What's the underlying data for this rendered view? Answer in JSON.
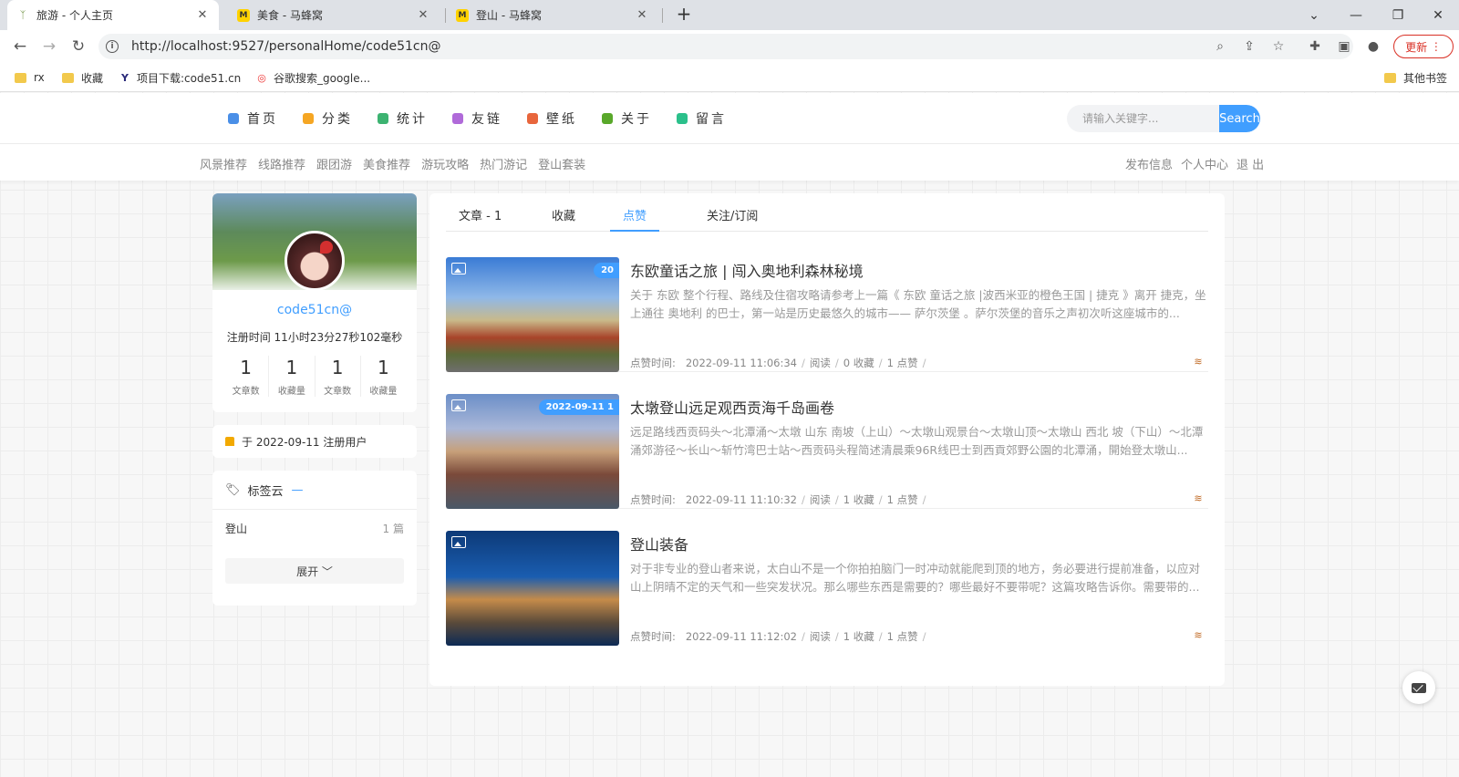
{
  "browser": {
    "tabs": [
      {
        "title": "旅游 - 个人主页",
        "active": true
      },
      {
        "title": "美食 - 马蜂窝",
        "active": false
      },
      {
        "title": "登山 - 马蜂窝",
        "active": false
      }
    ],
    "new_tab": "+",
    "url": "http://localhost:9527/personalHome/code51cn@",
    "update_label": "更新",
    "bookmarks": [
      "rx",
      "收藏",
      "项目下载:code51.cn",
      "谷歌搜索_google...",
      "其他书签"
    ]
  },
  "nav": {
    "menu": [
      {
        "label": "首页",
        "color": "#4a8fe7"
      },
      {
        "label": "分类",
        "color": "#f5a623"
      },
      {
        "label": "统计",
        "color": "#3cb371"
      },
      {
        "label": "友链",
        "color": "#b06ad9"
      },
      {
        "label": "壁纸",
        "color": "#e8663c"
      },
      {
        "label": "关于",
        "color": "#59a82a"
      },
      {
        "label": "留言",
        "color": "#2bc08b"
      }
    ],
    "search_placeholder": "请输入关键字...",
    "search_label": "Search"
  },
  "subnav": {
    "left": [
      "风景推荐",
      "线路推荐",
      "跟团游",
      "美食推荐",
      "游玩攻略",
      "热门游记",
      "登山套装"
    ],
    "right": [
      "发布信息",
      "个人中心",
      "退 出"
    ]
  },
  "profile": {
    "username": "code51cn@",
    "reg_time": "注册时间 11小时23分27秒102毫秒",
    "stats": [
      {
        "num": "1",
        "label": "文章数"
      },
      {
        "num": "1",
        "label": "收藏量"
      },
      {
        "num": "1",
        "label": "文章数"
      },
      {
        "num": "1",
        "label": "收藏量"
      }
    ],
    "registered": "于 2022-09-11 注册用户"
  },
  "tags": {
    "title": "标签云",
    "dash": "—",
    "items": [
      {
        "name": "登山",
        "count": "1 篇"
      }
    ],
    "expand_label": "展开 ﹀"
  },
  "content": {
    "tabs": [
      "文章 - 1",
      "收藏",
      "点赞",
      "关注/订阅"
    ],
    "active_tab": "点赞",
    "meta_prefix": "点赞时间:",
    "articles": [
      {
        "title": "东欧童话之旅 | 闯入奥地利森林秘境",
        "badge": "20",
        "desc": "关于 东欧 整个行程、路线及住宿攻略请参考上一篇《 东欧 童话之旅 |波西米亚的橙色王国 | 捷克 》离开 捷克，坐上通往 奥地利 的巴士，第一站是历史最悠久的城市—— 萨尔茨堡 。萨尔茨堡的音乐之声初次听这座城市的...",
        "time": "2022-09-11 11:06:34",
        "reads": "阅读",
        "favs": "0 收藏",
        "likes": "1 点赞"
      },
      {
        "title": "太墩登山远足观西贡海千岛画卷",
        "badge": "2022-09-11 1",
        "desc": "远足路线西贡码头～北潭涌～太墩 山东 南坡（上山）～太墩山观景台～太墩山顶～太墩山 西北 坡（下山）～北潭涌郊游径～长山～斩竹湾巴士站～西贡码头程简述清晨乘96R线巴士到西貢郊野公園的北潭涌，開始登太墩山...",
        "time": "2022-09-11 11:10:32",
        "reads": "阅读",
        "favs": "1 收藏",
        "likes": "1 点赞"
      },
      {
        "title": "登山装备",
        "badge": "",
        "desc": "对于非专业的登山者来说，太白山不是一个你拍拍脑门一时冲动就能爬到顶的地方，务必要进行提前准备，以应对山上阴晴不定的天气和一些突发状况。那么哪些东西是需要的？哪些最好不要带呢？这篇攻略告诉你。需要带的...",
        "time": "2022-09-11 11:12:02",
        "reads": "阅读",
        "favs": "1 收藏",
        "likes": "1 点赞"
      }
    ]
  }
}
